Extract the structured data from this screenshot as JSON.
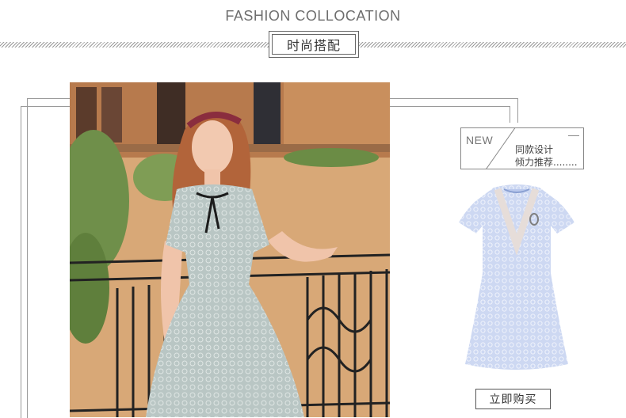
{
  "header": {
    "title": "FASHION COLLOCATION",
    "badge_label": "时尚搭配"
  },
  "new_card": {
    "tag": "NEW",
    "line1": "同款设计",
    "line2": "倾力推荐........"
  },
  "buy_button": {
    "label": "立即购买"
  },
  "colors": {
    "lace_dress_photo": "#b9c6c4",
    "product_dress": "#c6d2ee",
    "frame_lines": "#9a9a9a"
  }
}
